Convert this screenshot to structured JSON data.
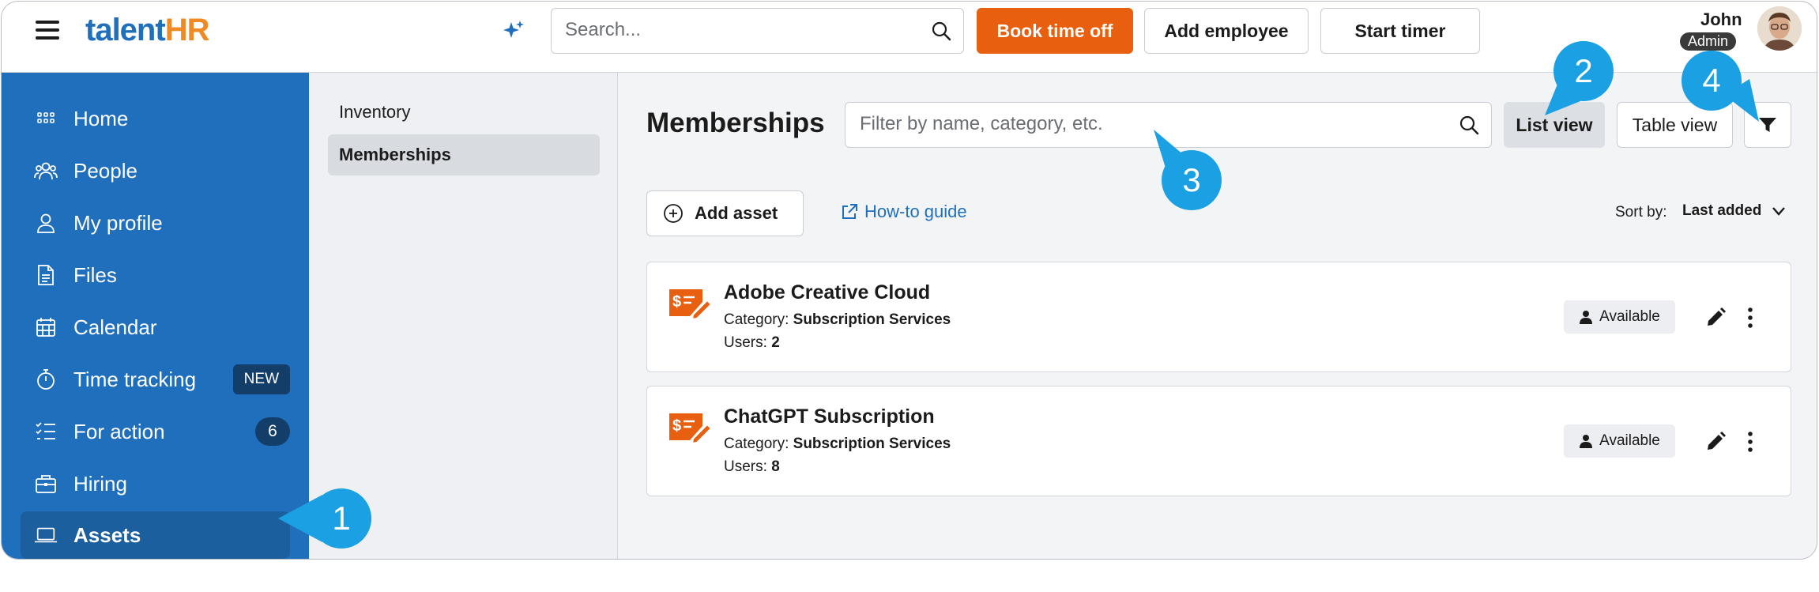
{
  "app": {
    "logo_part1": "talent",
    "logo_part2": "HR"
  },
  "topbar": {
    "search_placeholder": "Search...",
    "book_time_off": "Book time off",
    "add_employee": "Add employee",
    "start_timer": "Start timer",
    "user_name": "John",
    "user_role": "Admin"
  },
  "sidebar": {
    "items": [
      {
        "label": "Home",
        "icon": "home-grid-icon"
      },
      {
        "label": "People",
        "icon": "people-icon"
      },
      {
        "label": "My profile",
        "icon": "user-icon"
      },
      {
        "label": "Files",
        "icon": "file-icon"
      },
      {
        "label": "Calendar",
        "icon": "calendar-icon"
      },
      {
        "label": "Time tracking",
        "icon": "stopwatch-icon",
        "badge": "NEW"
      },
      {
        "label": "For action",
        "icon": "checklist-icon",
        "count": "6"
      },
      {
        "label": "Hiring",
        "icon": "briefcase-icon"
      },
      {
        "label": "Assets",
        "icon": "laptop-icon",
        "active": true
      }
    ]
  },
  "subnav": {
    "items": [
      {
        "label": "Inventory"
      },
      {
        "label": "Memberships",
        "active": true
      }
    ]
  },
  "main": {
    "title": "Memberships",
    "filter_placeholder": "Filter by name, category, etc.",
    "list_view": "List view",
    "table_view": "Table view",
    "add_asset": "Add asset",
    "how_to_guide": "How-to guide",
    "sort_label": "Sort by:",
    "sort_value": "Last added",
    "category_label": "Category:",
    "users_label": "Users:",
    "assets": [
      {
        "name": "Adobe Creative Cloud",
        "category": "Subscription Services",
        "users": "2",
        "status": "Available"
      },
      {
        "name": "ChatGPT Subscription",
        "category": "Subscription Services",
        "users": "8",
        "status": "Available"
      }
    ]
  },
  "callouts": [
    "1",
    "2",
    "3",
    "4"
  ],
  "colors": {
    "brand_blue": "#1f6fbd",
    "brand_orange": "#e8600f",
    "callout_blue": "#1aa0e3"
  }
}
